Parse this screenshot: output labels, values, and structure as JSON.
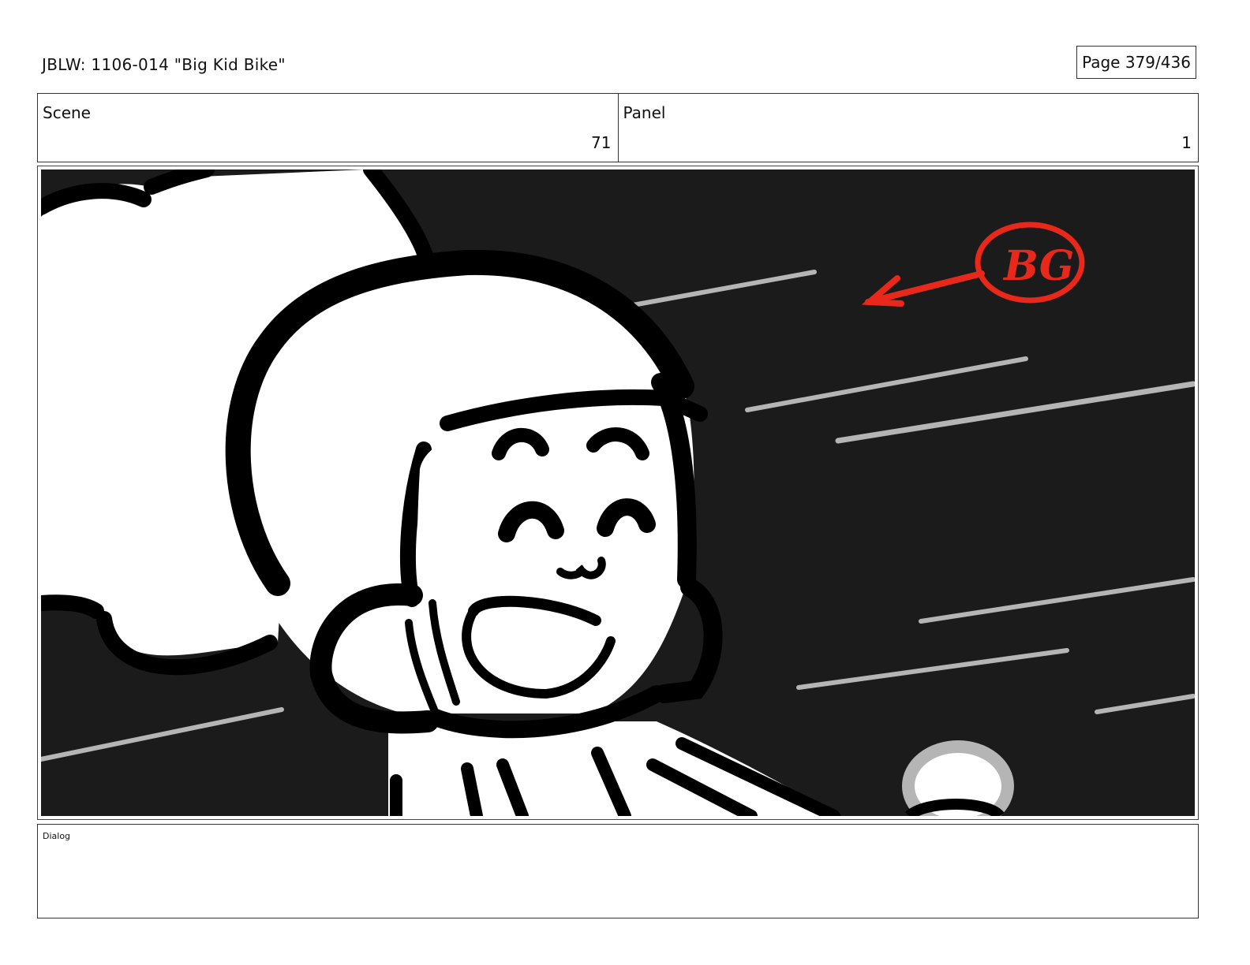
{
  "header": {
    "title": "JBLW: 1106-014 \"Big Kid Bike\"",
    "page": "Page 379/436"
  },
  "info": {
    "scene_label": "Scene",
    "scene_value": "71",
    "panel_label": "Panel",
    "panel_value": "1"
  },
  "artwork": {
    "description_icon": "storyboard-drawing",
    "annotation_text": "BG",
    "colors": {
      "background": "#1b1b1b",
      "ink": "#000000",
      "annotation": "#e8281a",
      "speed_lines": "#b5b5b5"
    }
  },
  "dialog": {
    "label": "Dialog",
    "text": ""
  }
}
